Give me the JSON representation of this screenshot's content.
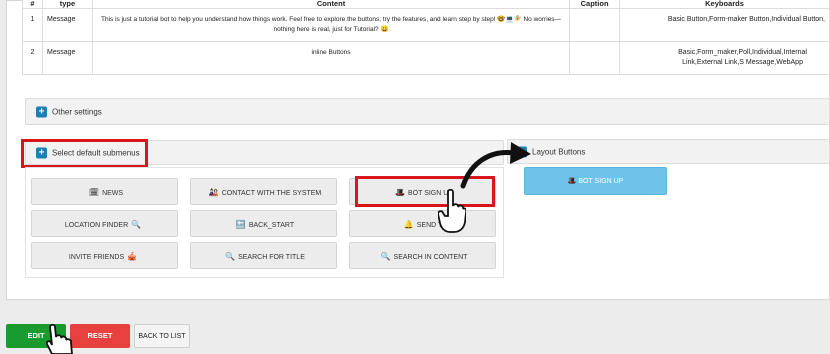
{
  "table": {
    "headers": {
      "num": "#",
      "type": "type",
      "content": "Content",
      "caption": "Caption",
      "keyboards": "Keyboards"
    },
    "rows": [
      {
        "num": "1",
        "type": "Message",
        "content": "This is just a tutorial bot to help you understand how things work. Feel free to explore the buttons, try the features, and learn step by step! 🤓💻🧚 No worries—nothing here is real, just for Tutorial? 😀",
        "caption": "",
        "keyboards": "Basic Button,Form-maker Button,Individual Button,"
      },
      {
        "num": "2",
        "type": "Message",
        "content": "inline Buttons",
        "caption": "",
        "keyboards": "Basic,Form_maker,Poll,Individual,Internal Link,External Link,S Message,WebApp"
      }
    ]
  },
  "accordions": {
    "other_settings": "Other settings",
    "select_default_submenus": "Select default submenus",
    "layout_buttons": "Layout Buttons"
  },
  "submenu_buttons": [
    {
      "label": "NEWS",
      "icon": "🗓",
      "icon_after": false
    },
    {
      "label": "CONTACT WITH THE SYSTEM",
      "icon": "🎎",
      "icon_after": false
    },
    {
      "label": "BOT SIGN UP",
      "icon": "🎩",
      "icon_after": false
    },
    {
      "label": "LOCATION FINDER",
      "icon": "🔍",
      "icon_after": true
    },
    {
      "label": "BACK_START",
      "icon": "🔙",
      "icon_after": false
    },
    {
      "label": "SEND TI",
      "icon": "🔔",
      "icon_after": false
    },
    {
      "label": "INVITE FRIENDS",
      "icon": "🎪",
      "icon_after": true
    },
    {
      "label": "SEARCH FOR TITLE",
      "icon": "🔍",
      "icon_after": false
    },
    {
      "label": "SEARCH IN CONTENT",
      "icon": "🔍",
      "icon_after": false
    }
  ],
  "layout": {
    "button_label": "BOT SIGN UP",
    "button_icon": "🎩"
  },
  "footer": {
    "edit": "EDIT",
    "reset": "RESET",
    "back": "BACK TO LIST"
  },
  "colors": {
    "accent_blue": "#1a7fb5",
    "highlight_red": "#d8141d",
    "layout_button": "#6fc3ea",
    "edit_green": "#1a9b2f",
    "reset_red": "#e83f3f"
  }
}
